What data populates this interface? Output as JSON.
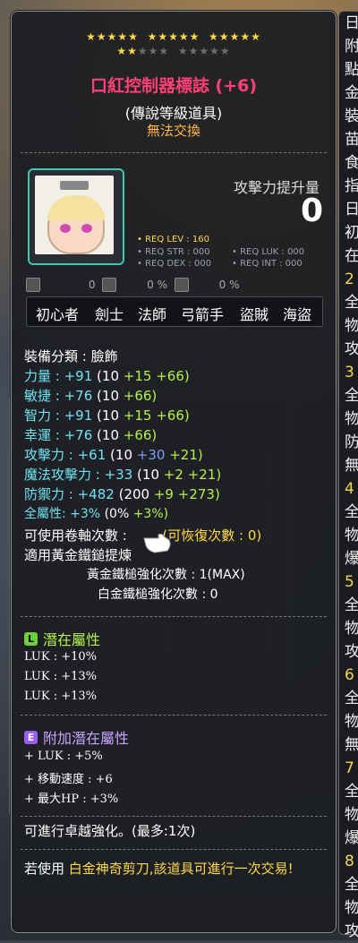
{
  "item": {
    "stars_on": 17,
    "stars_total": 25,
    "name": "口紅控制器標誌 (+6)",
    "grade": "(傳說等級道具)",
    "trade": "無法交換",
    "attack_increase_label": "攻擊力提升量",
    "attack_increase_value": "0",
    "req_lev": "• REQ LEV : 160",
    "req_str": "• REQ STR : 000",
    "req_luk": "• REQ LUK : 000",
    "req_dex": "• REQ DEX : 000",
    "req_int": "• REQ INT : 000",
    "small_stats": [
      "0",
      "0 %",
      "0 %"
    ],
    "jobs": [
      "初心者",
      "劍士",
      "法師",
      "弓箭手",
      "盜賊",
      "海盜"
    ]
  },
  "stats": {
    "category": "裝備分類 : 臉飾",
    "str": {
      "label": "力量 :",
      "total": "+91",
      "base": "(10",
      "bonus1": "+15",
      "bonus2": "+66)"
    },
    "dex": {
      "label": "敏捷 :",
      "total": "+76",
      "base": "(10",
      "bonus2": "+66)"
    },
    "int": {
      "label": "智力 :",
      "total": "+91",
      "base": "(10",
      "bonus1": "+15",
      "bonus2": "+66)"
    },
    "luk": {
      "label": "幸運 :",
      "total": "+76",
      "base": "(10",
      "bonus2": "+66)"
    },
    "atk": {
      "label": "攻擊力 :",
      "total": "+61",
      "base": "(10",
      "bonus1": "+30",
      "bonus2": "+21)"
    },
    "matk": {
      "label": "魔法攻擊力 :",
      "total": "+33",
      "base": "(10",
      "bonus1": "+2",
      "bonus2": "+21)"
    },
    "def": {
      "label": "防禦力 :",
      "total": "+482",
      "base": "(200",
      "bonus1": "+9",
      "bonus2": "+273)"
    },
    "allstat": {
      "label": "全屬性:",
      "total": "+3%",
      "base": "(0%",
      "bonus2": "+3%)"
    },
    "scroll": "可使用卷軸次數 :",
    "scroll_recover": "(可恢復次數 : 0)",
    "hammer": "適用黃金鐵鎚提煉",
    "gold_hammer": "黃金鐵槌強化次數 : 1(MAX)",
    "platinum_hammer": "白金鐵槌強化次數 : 0"
  },
  "potential": {
    "title": "潛在屬性",
    "badge": "L",
    "lines": [
      "LUK : +10%",
      "LUK : +13%",
      "LUK : +13%"
    ]
  },
  "additional": {
    "title": "附加潛在屬性",
    "badge": "E",
    "lines": [
      "+ LUK : +5%",
      "+ 移動速度 : +6",
      "+ 最大HP : +3%"
    ]
  },
  "footer": {
    "star_force": "可進行卓越強化。(最多:1次)",
    "scissors_prefix": "若使用 ",
    "scissors_name": "白金神奇剪刀",
    "scissors_suffix": ",該道具可進行一次交易!"
  },
  "side_panel": {
    "lines": [
      "日",
      "附",
      "點",
      "金",
      "裝",
      "苗",
      "食",
      "指",
      "日",
      "初",
      "在",
      "2",
      "全",
      "物",
      "攻",
      "3",
      "全",
      "物",
      "防",
      "無",
      "4",
      "全",
      "物",
      "爆",
      "5",
      "全",
      "物",
      "攻",
      "6",
      "全",
      "物",
      "無",
      "7",
      "全",
      "物",
      "爆",
      "8",
      "全",
      "物",
      "攻"
    ]
  },
  "colors": {
    "accent": "#41c6b0",
    "title": "#ff3f7a",
    "stat": "#6fe2f0",
    "bonus": "#b5f04a"
  }
}
